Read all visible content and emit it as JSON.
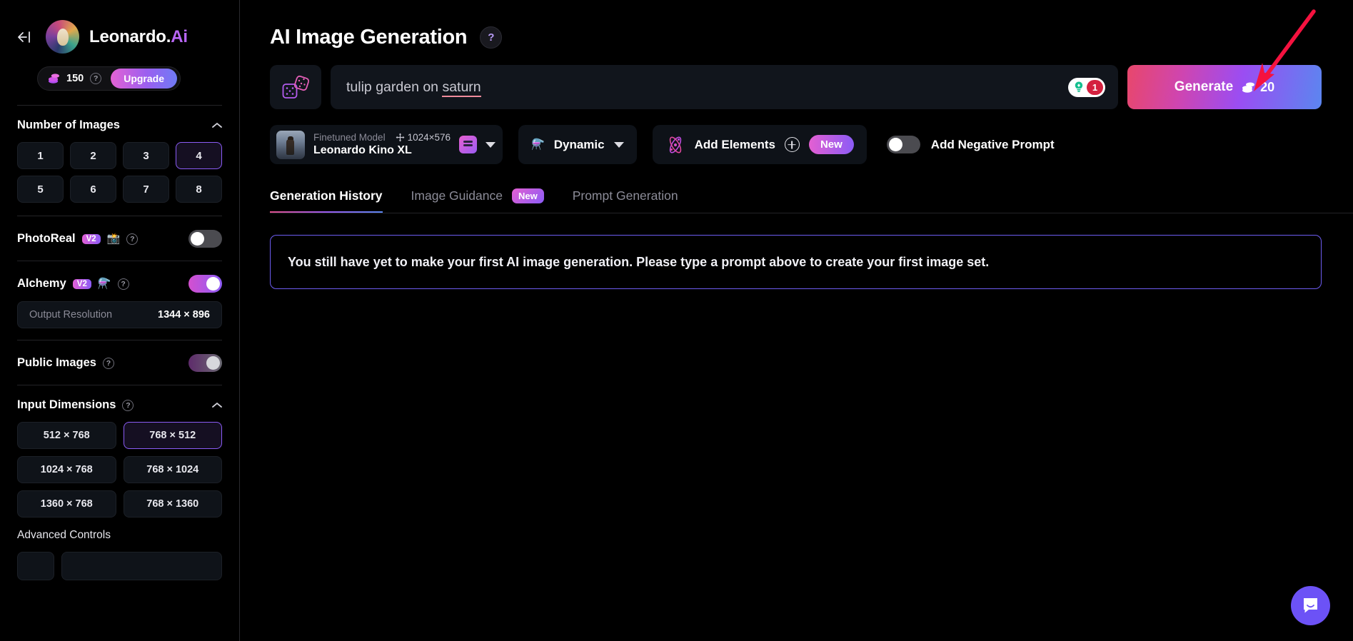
{
  "sidebar": {
    "back_icon": "back-arrow-icon",
    "brand_name": "Leonardo.",
    "brand_suffix": "Ai",
    "credits": "150",
    "credits_help": "?",
    "upgrade_label": "Upgrade",
    "number_of_images": {
      "title": "Number of Images",
      "options": [
        "1",
        "2",
        "3",
        "4",
        "5",
        "6",
        "7",
        "8"
      ],
      "selected": "4"
    },
    "photoreal": {
      "label": "PhotoReal",
      "badge": "V2",
      "emoji": "📸",
      "help": "?",
      "enabled": false
    },
    "alchemy": {
      "label": "Alchemy",
      "badge": "V2",
      "emoji": "⚗️",
      "help": "?",
      "enabled": true
    },
    "output_resolution": {
      "label": "Output Resolution",
      "value": "1344 × 896"
    },
    "public_images": {
      "label": "Public Images",
      "help": "?",
      "enabled": true
    },
    "input_dimensions": {
      "title": "Input Dimensions",
      "help": "?",
      "options": [
        "512 × 768",
        "768 × 512",
        "1024 × 768",
        "768 × 1024",
        "1360 × 768",
        "768 × 1360"
      ],
      "selected": "768 × 512"
    },
    "advanced_controls": "Advanced Controls"
  },
  "main": {
    "page_title": "AI Image Generation",
    "page_title_help": "?",
    "prompt": {
      "dice_icon": "dice-icon",
      "text_before": "tulip garden on ",
      "misspelled_word": "saturn",
      "grammarly_count": "1"
    },
    "generate": {
      "label": "Generate",
      "cost": "20"
    },
    "model": {
      "kind": "Finetuned Model",
      "dimensions": "1024×576",
      "name": "Leonardo Kino XL"
    },
    "preset": {
      "emoji": "⚗️",
      "label": "Dynamic"
    },
    "elements": {
      "label": "Add Elements",
      "badge": "New"
    },
    "negative_prompt": {
      "label": "Add Negative Prompt",
      "enabled": false
    },
    "tabs": [
      {
        "label": "Generation History",
        "active": true,
        "badge": ""
      },
      {
        "label": "Image Guidance",
        "active": false,
        "badge": "New"
      },
      {
        "label": "Prompt Generation",
        "active": false,
        "badge": ""
      }
    ],
    "empty_message": "You still have yet to make your first AI image generation. Please type a prompt above to create your first image set.",
    "chat_icon": "chat-bubble-icon",
    "annotation_arrow": "red-arrow-icon"
  },
  "colors": {
    "accent_purple": "#8b5cf6",
    "accent_pink": "#e45fd2",
    "accent_blue": "#5b86f0",
    "annotation_red": "#f5123f",
    "panel": "#0f1319"
  }
}
